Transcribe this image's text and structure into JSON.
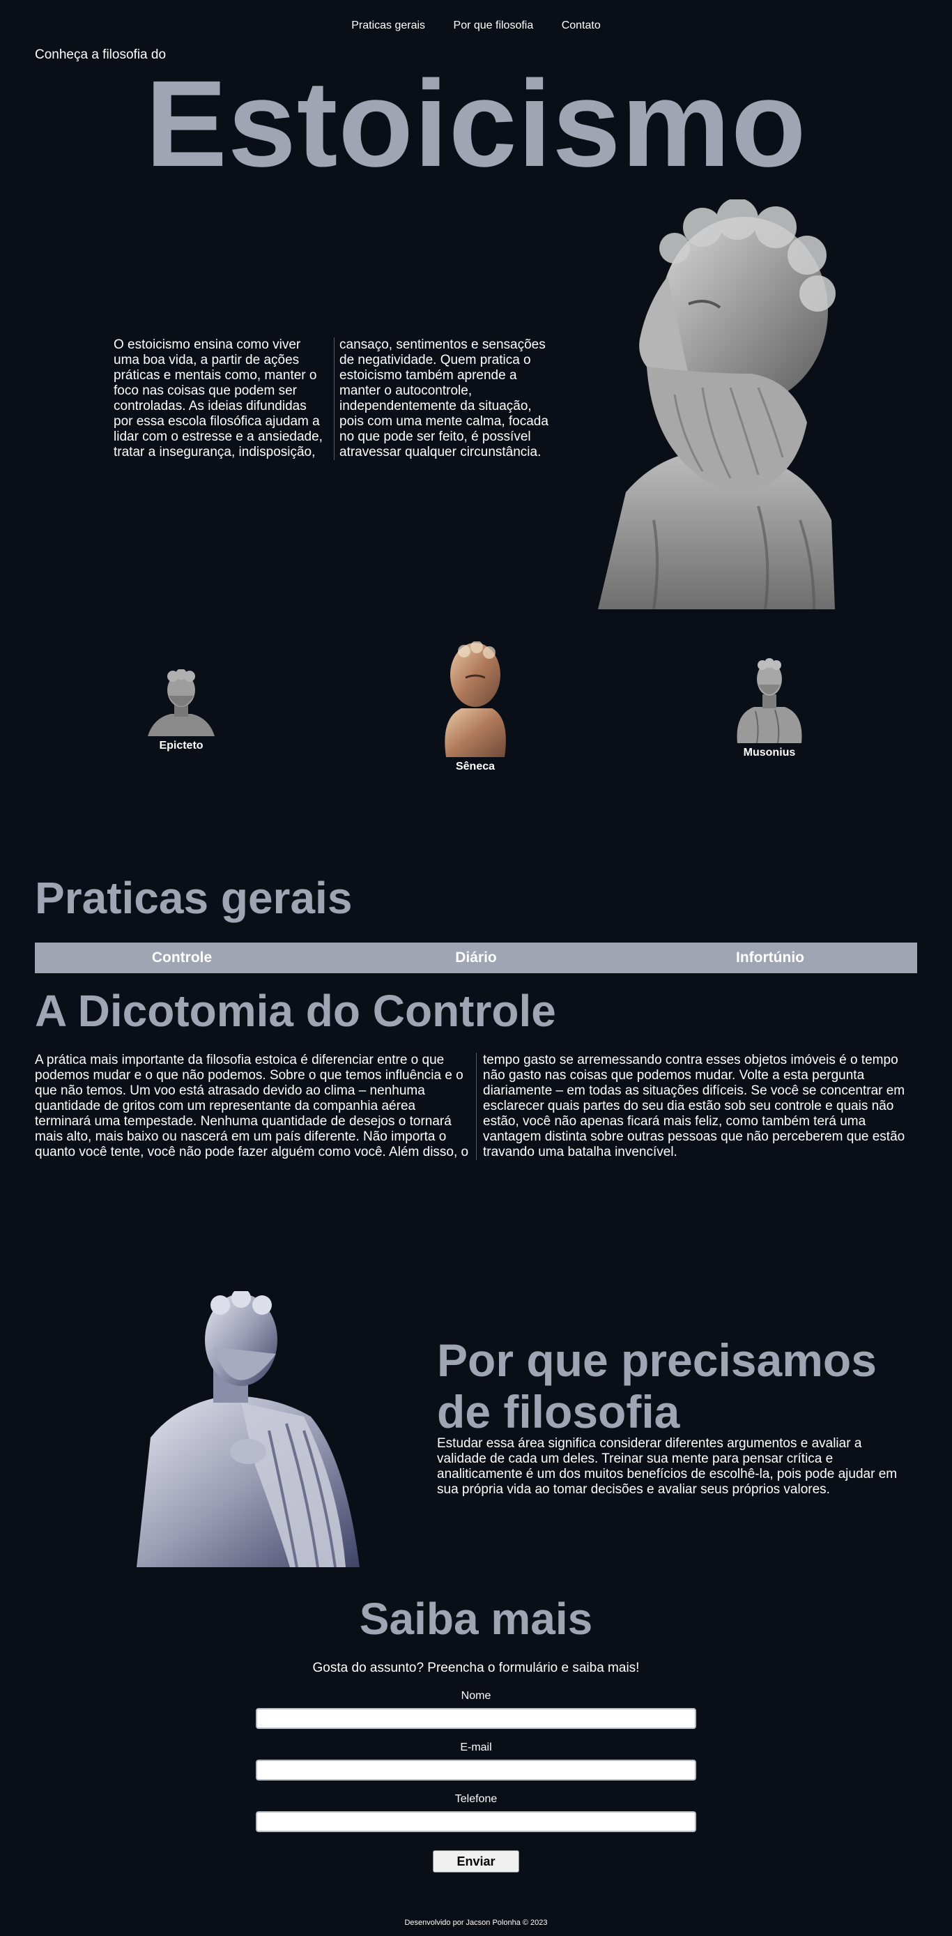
{
  "nav": {
    "items": [
      "Praticas gerais",
      "Por que filosofia",
      "Contato"
    ]
  },
  "hero": {
    "intro": "Conheça a filosofia do",
    "title": "Estoicismo",
    "text": "O estoicismo ensina como viver uma boa vida, a partir de ações práticas e mentais como, manter o foco nas coisas que podem ser controladas. As ideias difundidas por essa escola filosófica ajudam a lidar com o estresse e a ansiedade, tratar a insegurança, indisposição, cansaço, sentimentos e sensações de negatividade. Quem pratica o estoicismo também aprende a manter o autocontrole, independentemente da situação, pois com uma mente calma, focada no que pode ser feito, é possível atravessar qualquer circunstância."
  },
  "philosophers": [
    "Epicteto",
    "Sêneca",
    "Musonius"
  ],
  "practices": {
    "title": "Praticas gerais",
    "tabs": [
      "Controle",
      "Diário",
      "Infortúnio"
    ],
    "subtitle": "A Dicotomia do Controle",
    "text": "A prática mais importante da filosofia estoica é diferenciar entre o que podemos mudar e o que não podemos. Sobre o que temos influência e o que não temos. Um voo está atrasado devido ao clima – nenhuma quantidade de gritos com um representante da companhia aérea terminará uma tempestade. Nenhuma quantidade de desejos o tornará mais alto, mais baixo ou nascerá em um país diferente. Não importa o quanto você tente, você não pode fazer alguém como você. Além disso, o tempo gasto se arremessando contra esses objetos imóveis é o tempo não gasto nas coisas que podemos mudar. Volte a esta pergunta diariamente – em todas as situações difíceis. Se você se concentrar em esclarecer quais partes do seu dia estão sob seu controle e quais não estão, você não apenas ficará mais feliz, como também terá uma vantagem distinta sobre outras pessoas que não perceberem que estão travando uma batalha invencível."
  },
  "why": {
    "title_line1": "Por que precisamos",
    "title_line2": "de filosofia",
    "text": "Estudar essa área significa considerar diferentes argumentos e avaliar a validade de cada um deles. Treinar sua mente para pensar crítica e analiticamente é um dos muitos benefícios de escolhê-la, pois pode ajudar em sua própria vida ao tomar decisões e avaliar seus próprios valores."
  },
  "contact": {
    "title": "Saiba mais",
    "subtitle": "Gosta do assunto? Preencha o formulário e saiba mais!",
    "name_label": "Nome",
    "email_label": "E-mail",
    "phone_label": "Telefone",
    "submit_label": "Enviar"
  },
  "footer": {
    "text": "Desenvolvido por Jacson Polonha © 2023"
  },
  "colors": {
    "background": "#0a0e17",
    "accent": "#a0a5b4",
    "text": "#ffffff"
  }
}
